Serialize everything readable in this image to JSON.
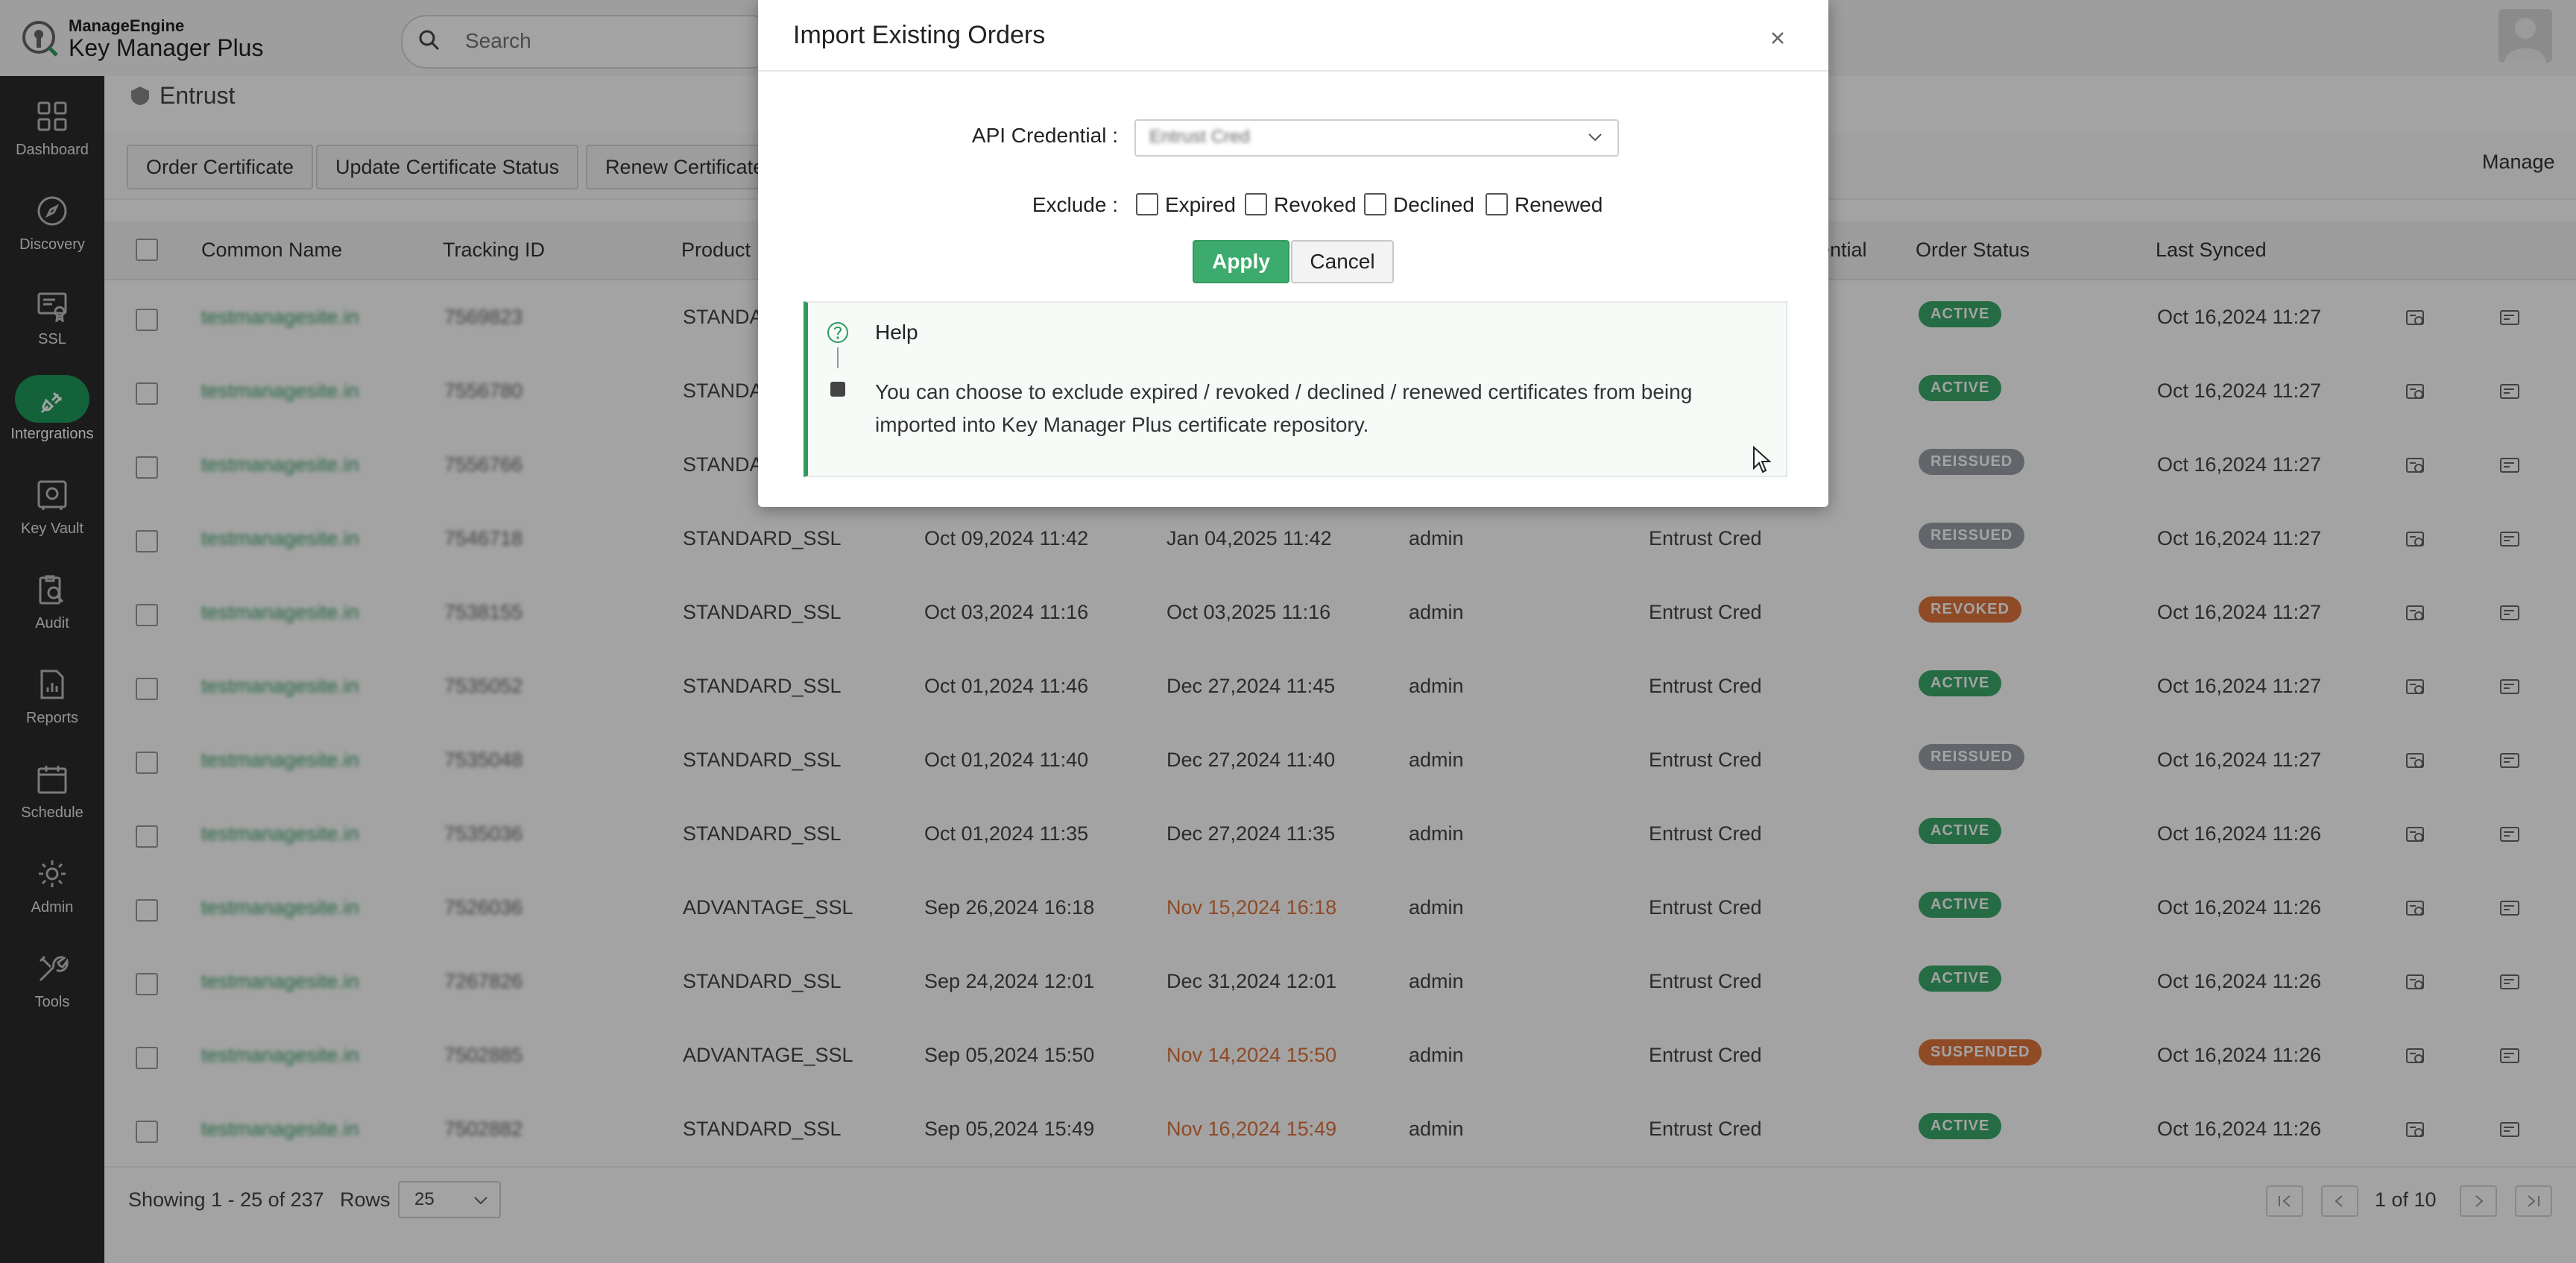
{
  "app": {
    "brand": "ManageEngine",
    "product": "Key Manager Plus"
  },
  "search": {
    "placeholder": "Search"
  },
  "sidebar": {
    "items": [
      {
        "label": "Dashboard",
        "icon": "dashboard-icon"
      },
      {
        "label": "Discovery",
        "icon": "compass-icon"
      },
      {
        "label": "SSL",
        "icon": "certificate-icon"
      },
      {
        "label": "Intergrations",
        "icon": "plug-icon",
        "active": true
      },
      {
        "label": "Key Vault",
        "icon": "vault-icon"
      },
      {
        "label": "Audit",
        "icon": "audit-icon"
      },
      {
        "label": "Reports",
        "icon": "reports-icon"
      },
      {
        "label": "Schedule",
        "icon": "calendar-icon"
      },
      {
        "label": "Admin",
        "icon": "gear-icon"
      },
      {
        "label": "Tools",
        "icon": "tools-icon"
      }
    ]
  },
  "page": {
    "breadcrumb": "Entrust",
    "manage_label": "Manage"
  },
  "toolbar": {
    "buttons": [
      "Order Certificate",
      "Update Certificate Status",
      "Renew Certificate"
    ]
  },
  "table": {
    "columns": {
      "common_name": "Common Name",
      "tracking_id": "Tracking ID",
      "product": "Product",
      "credential": "ential",
      "order_status": "Order Status",
      "last_synced": "Last Synced"
    },
    "rows": [
      {
        "cn": "testmanagesite.in",
        "tid": "7569823",
        "product": "STANDARD_SSL",
        "start": "",
        "end": "",
        "end_warn": false,
        "user": "",
        "cred": "",
        "status": "ACTIVE",
        "synced": "Oct 16,2024 11:27"
      },
      {
        "cn": "testmanagesite.in",
        "tid": "7556780",
        "product": "STANDARD_SSL",
        "start": "",
        "end": "",
        "end_warn": false,
        "user": "",
        "cred": "",
        "status": "ACTIVE",
        "synced": "Oct 16,2024 11:27"
      },
      {
        "cn": "testmanagesite.in",
        "tid": "7556766",
        "product": "STANDARD_SSL",
        "start": "",
        "end": "",
        "end_warn": false,
        "user": "",
        "cred": "",
        "status": "REISSUED",
        "synced": "Oct 16,2024 11:27"
      },
      {
        "cn": "testmanagesite.in",
        "tid": "7546718",
        "product": "STANDARD_SSL",
        "start": "Oct 09,2024 11:42",
        "end": "Jan 04,2025 11:42",
        "end_warn": false,
        "user": "admin",
        "cred": "Entrust Cred",
        "status": "REISSUED",
        "synced": "Oct 16,2024 11:27"
      },
      {
        "cn": "testmanagesite.in",
        "tid": "7538155",
        "product": "STANDARD_SSL",
        "start": "Oct 03,2024 11:16",
        "end": "Oct 03,2025 11:16",
        "end_warn": false,
        "user": "admin",
        "cred": "Entrust Cred",
        "status": "REVOKED",
        "synced": "Oct 16,2024 11:27"
      },
      {
        "cn": "testmanagesite.in",
        "tid": "7535052",
        "product": "STANDARD_SSL",
        "start": "Oct 01,2024 11:46",
        "end": "Dec 27,2024 11:45",
        "end_warn": false,
        "user": "admin",
        "cred": "Entrust Cred",
        "status": "ACTIVE",
        "synced": "Oct 16,2024 11:27"
      },
      {
        "cn": "testmanagesite.in",
        "tid": "7535048",
        "product": "STANDARD_SSL",
        "start": "Oct 01,2024 11:40",
        "end": "Dec 27,2024 11:40",
        "end_warn": false,
        "user": "admin",
        "cred": "Entrust Cred",
        "status": "REISSUED",
        "synced": "Oct 16,2024 11:27"
      },
      {
        "cn": "testmanagesite.in",
        "tid": "7535036",
        "product": "STANDARD_SSL",
        "start": "Oct 01,2024 11:35",
        "end": "Dec 27,2024 11:35",
        "end_warn": false,
        "user": "admin",
        "cred": "Entrust Cred",
        "status": "ACTIVE",
        "synced": "Oct 16,2024 11:26"
      },
      {
        "cn": "testmanagesite.in",
        "tid": "7526036",
        "product": "ADVANTAGE_SSL",
        "start": "Sep 26,2024 16:18",
        "end": "Nov 15,2024 16:18",
        "end_warn": true,
        "user": "admin",
        "cred": "Entrust Cred",
        "status": "ACTIVE",
        "synced": "Oct 16,2024 11:26"
      },
      {
        "cn": "testmanagesite.in",
        "tid": "7267826",
        "product": "STANDARD_SSL",
        "start": "Sep 24,2024 12:01",
        "end": "Dec 31,2024 12:01",
        "end_warn": false,
        "user": "admin",
        "cred": "Entrust Cred",
        "status": "ACTIVE",
        "synced": "Oct 16,2024 11:26"
      },
      {
        "cn": "testmanagesite.in",
        "tid": "7502885",
        "product": "ADVANTAGE_SSL",
        "start": "Sep 05,2024 15:50",
        "end": "Nov 14,2024 15:50",
        "end_warn": true,
        "user": "admin",
        "cred": "Entrust Cred",
        "status": "SUSPENDED",
        "synced": "Oct 16,2024 11:26"
      },
      {
        "cn": "testmanagesite.in",
        "tid": "7502882",
        "product": "STANDARD_SSL",
        "start": "Sep 05,2024 15:49",
        "end": "Nov 16,2024 15:49",
        "end_warn": true,
        "user": "admin",
        "cred": "Entrust Cred",
        "status": "ACTIVE",
        "synced": "Oct 16,2024 11:26"
      }
    ],
    "status_colors": {
      "ACTIVE": "#3aa86a",
      "REISSUED": "#9aa0a6",
      "REVOKED": "#e0743c",
      "SUSPENDED": "#e0743c"
    },
    "warn_color": "#e0743c"
  },
  "footer": {
    "showing": "Showing 1 - 25 of 237",
    "rows_label": "Rows",
    "rows_value": "25",
    "page_label": "1 of 10"
  },
  "modal": {
    "title": "Import Existing Orders",
    "api_label": "API Credential :",
    "api_value": "Entrust Cred",
    "exclude_label": "Exclude :",
    "options": [
      "Expired",
      "Revoked",
      "Declined",
      "Renewed"
    ],
    "apply": "Apply",
    "cancel": "Cancel",
    "help_title": "Help",
    "help_text": "You can choose to exclude expired / revoked / declined / renewed certificates from being imported into Key Manager Plus certificate repository."
  }
}
